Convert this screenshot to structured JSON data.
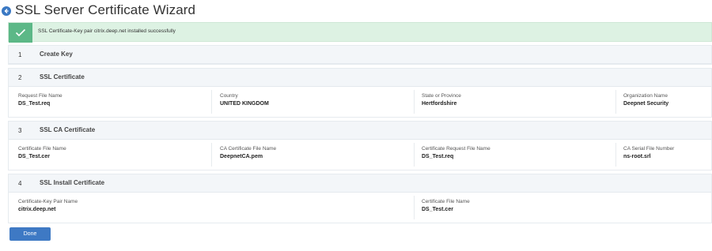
{
  "header": {
    "title": "SSL Server Certificate Wizard",
    "back_icon": "back-arrow-icon"
  },
  "banner": {
    "message": "SSL Certificate-Key pair citrix.deep.net installed successfully",
    "icon": "checkmark-icon",
    "color": "#5cb887"
  },
  "steps": [
    {
      "number": "1",
      "title": "Create Key",
      "fields": []
    },
    {
      "number": "2",
      "title": "SSL Certificate",
      "fields": [
        {
          "label": "Request File Name",
          "value": "DS_Test.req"
        },
        {
          "label": "Country",
          "value": "UNITED KINGDOM"
        },
        {
          "label": "State or Province",
          "value": "Hertfordshire"
        },
        {
          "label": "Organization Name",
          "value": "Deepnet Security"
        }
      ]
    },
    {
      "number": "3",
      "title": "SSL CA Certificate",
      "fields": [
        {
          "label": "Certificate File Name",
          "value": "DS_Test.cer"
        },
        {
          "label": "CA Certificate File Name",
          "value": "DeepnetCA.pem"
        },
        {
          "label": "Certificate Request File Name",
          "value": "DS_Test.req"
        },
        {
          "label": "CA Serial File Number",
          "value": "ns-root.srl"
        }
      ]
    },
    {
      "number": "4",
      "title": "SSL Install Certificate",
      "fields": [
        {
          "label": "Certificate-Key Pair Name",
          "value": "citrix.deep.net"
        },
        {
          "label": "Certificate File Name",
          "value": "DS_Test.cer"
        }
      ]
    }
  ],
  "done_button": {
    "label": "Done",
    "color": "#3e79c4"
  }
}
